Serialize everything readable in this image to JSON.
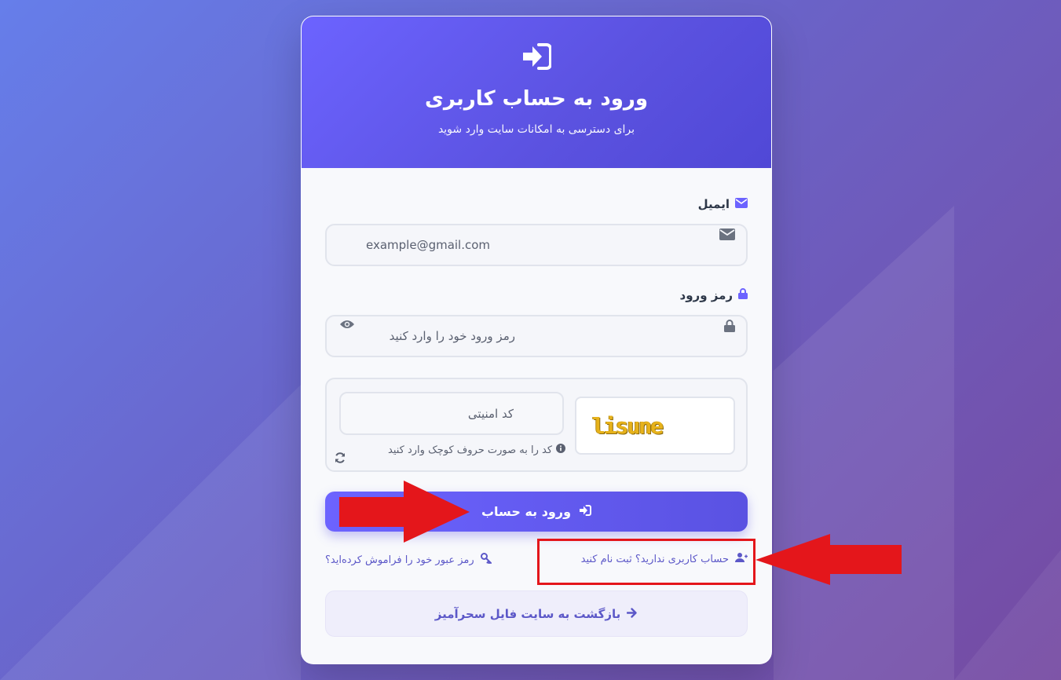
{
  "header": {
    "icon": "sign-in-icon",
    "title": "ورود به حساب کاربری",
    "subtitle": "برای دسترسی به امکانات سایت وارد شوید"
  },
  "email": {
    "label": "ایمیل",
    "label_icon": "envelope-icon",
    "placeholder": "example@gmail.com",
    "value": ""
  },
  "password": {
    "label": "رمز ورود",
    "label_icon": "lock-icon",
    "placeholder": "رمز ورود خود را وارد کنید",
    "value": "",
    "toggle_icon": "eye-icon"
  },
  "captcha": {
    "image_text": "lisune",
    "placeholder": "کد امنیتی",
    "hint": "کد را به صورت حروف کوچک وارد کنید",
    "hint_icon": "info-icon",
    "refresh_icon": "refresh-icon"
  },
  "submit": {
    "label": "ورود به حساب",
    "icon": "sign-in-icon"
  },
  "links": {
    "register": "حساب کاربری ندارید؟ ثبت نام کنید",
    "register_icon": "user-plus-icon",
    "forgot": "رمز عبور خود را فراموش کرده‌اید؟",
    "forgot_icon": "key-icon"
  },
  "back": {
    "label": "بازگشت به سایت فایل سحرآمیز",
    "icon": "arrow-right-icon"
  },
  "colors": {
    "primary": "#6c63ff",
    "annotation": "#e4161b",
    "captcha_text": "#e7b21a"
  }
}
